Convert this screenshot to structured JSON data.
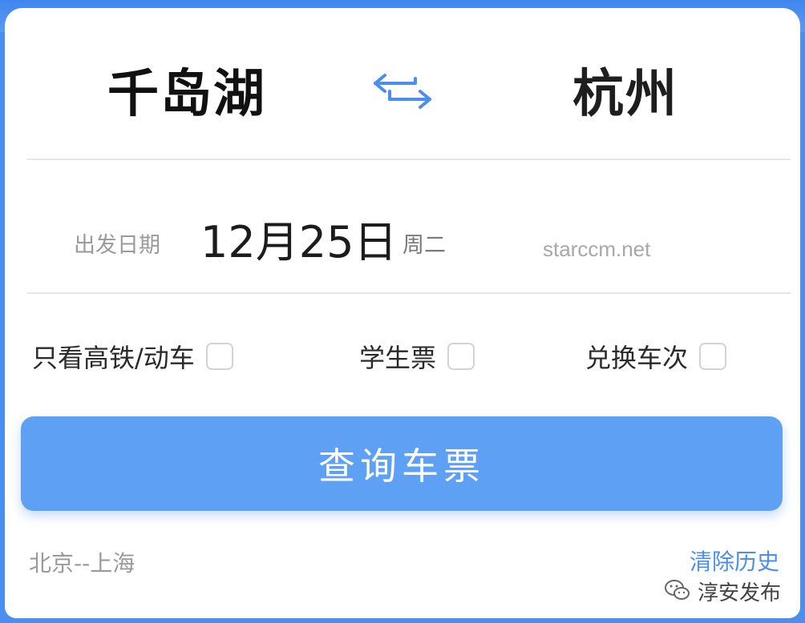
{
  "route": {
    "from_city": "千岛湖",
    "to_city": "杭州",
    "swap_icon": "swap-arrows-icon"
  },
  "date": {
    "label": "出发日期",
    "value": "12月25日",
    "weekday": "周二"
  },
  "watermark": "starccm.net",
  "options": [
    {
      "label": "只看高铁/动车",
      "checked": false
    },
    {
      "label": "学生票",
      "checked": false
    },
    {
      "label": "兑换车次",
      "checked": false
    }
  ],
  "search_button": {
    "label": "查询车票"
  },
  "history": {
    "item": "北京--上海",
    "clear_label": "清除历史"
  },
  "brand": {
    "name": "淳安发布",
    "icon": "wechat-icon"
  },
  "colors": {
    "accent": "#5ea0f4",
    "link": "#4a8ef0",
    "background": "#4a8ef0"
  }
}
